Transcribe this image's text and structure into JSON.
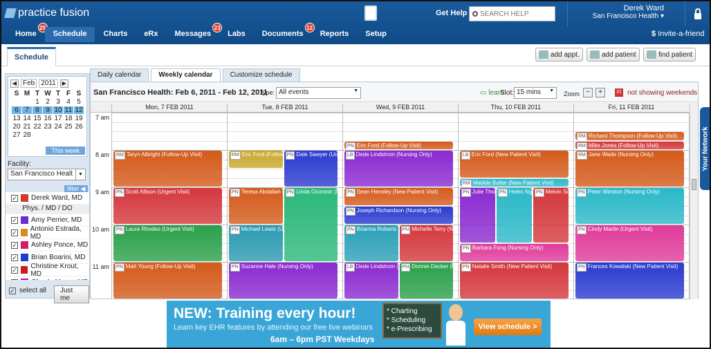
{
  "header": {
    "logo_text": "practice fusion",
    "get_help": "Get Help",
    "search_placeholder": "SEARCH HELP",
    "user_name": "Derek Ward",
    "user_clinic": "San Francisco Health",
    "invite": "Invite-a-friend"
  },
  "nav": [
    {
      "label": "Home",
      "badge": "29"
    },
    {
      "label": "Schedule",
      "badge": ""
    },
    {
      "label": "Charts",
      "badge": ""
    },
    {
      "label": "eRx",
      "badge": ""
    },
    {
      "label": "Messages",
      "badge": "23"
    },
    {
      "label": "Labs",
      "badge": ""
    },
    {
      "label": "Documents",
      "badge": "12"
    },
    {
      "label": "Reports",
      "badge": ""
    },
    {
      "label": "Setup",
      "badge": ""
    }
  ],
  "subbar": {
    "tab": "Schedule",
    "add_appt": "add appt.",
    "add_patient": "add patient",
    "find_patient": "find patient"
  },
  "minical": {
    "month": "Feb",
    "year": "2011",
    "days_header": [
      "S",
      "M",
      "T",
      "W",
      "T",
      "F",
      "S"
    ],
    "days": [
      "",
      "",
      "1",
      "2",
      "3",
      "4",
      "5",
      "6",
      "7",
      "8",
      "9",
      "10",
      "11",
      "12",
      "13",
      "14",
      "15",
      "16",
      "17",
      "18",
      "19",
      "20",
      "21",
      "22",
      "23",
      "24",
      "25",
      "26",
      "27",
      "28",
      "",
      "",
      "",
      "",
      ""
    ],
    "this_week": "This week"
  },
  "facility": {
    "label": "Facility:",
    "value": "San Francisco Healt"
  },
  "filter": "filter",
  "providers": {
    "self": {
      "name": "Derek Ward, MD",
      "color": "#d4372c"
    },
    "header": "Phys. / MD / DO",
    "list": [
      {
        "name": "Amy Perrier, MD",
        "color": "#6a2bd0"
      },
      {
        "name": "Antonio Estrada, MD",
        "color": "#d98a1c"
      },
      {
        "name": "Ashley Ponce, MD",
        "color": "#d61a6a"
      },
      {
        "name": "Brian Boarini, MD",
        "color": "#1a3ccf"
      },
      {
        "name": "Christine Krout, MD",
        "color": "#cf1a1a"
      },
      {
        "name": "Claude Meyer, MD",
        "color": "#9a1ac0"
      }
    ]
  },
  "select_all": "select all",
  "just_me": "Just me",
  "tabs": [
    "Daily calendar",
    "Weekly calendar",
    "Customize schedule"
  ],
  "calbar": {
    "range": "San Francisco Health:  Feb 6, 2011 - Feb 12, 2011",
    "type_label": "Type:",
    "type_value": "All events",
    "learn": "learn",
    "slot_label": "Slot:",
    "slot_value": "15 mins",
    "zoom_label": "Zoom",
    "weekends": "not showing weekends"
  },
  "days": [
    "Mon, 7 FEB 2011",
    "Tue, 8 FEB 2011",
    "Wed, 9 FEB 2011",
    "Thu, 10 FEB 2011",
    "Fri, 11 FEB 2011"
  ],
  "times": [
    "7 am",
    "8 am",
    "9 am",
    "10 am",
    "11 am"
  ],
  "appointments": [
    {
      "day": 0,
      "col": 0,
      "cols": 1,
      "start": 8.0,
      "end": 9.0,
      "tag": "RM",
      "text": "Taryn Albright (Follow-Up Visit)",
      "color": "#d45a1a"
    },
    {
      "day": 0,
      "col": 0,
      "cols": 1,
      "start": 9.0,
      "end": 10.0,
      "tag": "PN",
      "text": "Scott Allison (Urgent Visit)",
      "color": "#d4373c"
    },
    {
      "day": 0,
      "col": 0,
      "cols": 1,
      "start": 10.0,
      "end": 11.0,
      "tag": "PN",
      "text": "Laura Rhodes (Urgent Visit)",
      "color": "#2aa04a"
    },
    {
      "day": 0,
      "col": 0,
      "cols": 1,
      "start": 11.0,
      "end": 12.0,
      "tag": "PN",
      "text": "Matt Young (Follow-Up Visit)",
      "color": "#d45a1a"
    },
    {
      "day": 1,
      "col": 0,
      "cols": 2,
      "start": 8.0,
      "end": 8.5,
      "tag": "RM",
      "text": "Eric Ford (Follow-Up",
      "color": "#c8a82a"
    },
    {
      "day": 1,
      "col": 1,
      "cols": 2,
      "start": 8.0,
      "end": 9.0,
      "tag": "PN",
      "text": "Dale Sawyer (Urge",
      "color": "#2a3acf"
    },
    {
      "day": 1,
      "col": 0,
      "cols": 2,
      "start": 9.0,
      "end": 10.0,
      "tag": "PN",
      "text": "Teresa Abdallah (Ne",
      "color": "#d45a1a"
    },
    {
      "day": 1,
      "col": 1,
      "cols": 2,
      "start": 9.0,
      "end": 11.0,
      "tag": "PN",
      "text": "Linda Oconnor (Nursing",
      "color": "#2ab87a"
    },
    {
      "day": 1,
      "col": 0,
      "cols": 2,
      "start": 10.0,
      "end": 11.0,
      "tag": "PN",
      "text": "Michael Lewis (Urgent",
      "color": "#2a9ab0"
    },
    {
      "day": 1,
      "col": 0,
      "cols": 1,
      "start": 11.0,
      "end": 12.0,
      "tag": "PN",
      "text": "Suzanne Hale (Nursing Only)",
      "color": "#8a2ad0"
    },
    {
      "day": 2,
      "col": 0,
      "cols": 1,
      "start": 7.75,
      "end": 8.0,
      "tag": "PN",
      "text": "Eric Ford (Follow-Up Visit)",
      "color": "#d45a1a"
    },
    {
      "day": 2,
      "col": 0,
      "cols": 1,
      "start": 8.0,
      "end": 9.0,
      "tag": "LB",
      "text": "Dede Lindstrom (Nursing Only)",
      "color": "#8a2ad0"
    },
    {
      "day": 2,
      "col": 0,
      "cols": 1,
      "start": 9.0,
      "end": 9.5,
      "tag": "PN",
      "text": "Sean Hensley (New Patient Visit)",
      "color": "#d45a1a"
    },
    {
      "day": 2,
      "col": 0,
      "cols": 1,
      "start": 9.5,
      "end": 10.0,
      "tag": "PN",
      "text": "Joseph Richardson (Nursing Only)",
      "color": "#2a3acf"
    },
    {
      "day": 2,
      "col": 0,
      "cols": 2,
      "start": 10.0,
      "end": 11.0,
      "tag": "PN",
      "text": "Brianna Roberts (N",
      "color": "#2aa0b8"
    },
    {
      "day": 2,
      "col": 1,
      "cols": 2,
      "start": 10.0,
      "end": 11.0,
      "tag": "PN",
      "text": "Michelle Terry (N",
      "color": "#d4373c"
    },
    {
      "day": 2,
      "col": 0,
      "cols": 2,
      "start": 11.0,
      "end": 12.0,
      "tag": "LB",
      "text": "Dede Lindstrom (Nu",
      "color": "#8a2ad0"
    },
    {
      "day": 2,
      "col": 1,
      "cols": 2,
      "start": 11.0,
      "end": 12.0,
      "tag": "PN",
      "text": "Donnie Decker (Fo",
      "color": "#2aa04a"
    },
    {
      "day": 3,
      "col": 0,
      "cols": 1,
      "start": 8.0,
      "end": 8.75,
      "tag": "LB",
      "text": "Eric Ford (New Patient Visit)",
      "color": "#d45a1a"
    },
    {
      "day": 3,
      "col": 0,
      "cols": 1,
      "start": 8.75,
      "end": 9.0,
      "tag": "RM",
      "text": "Matilde Butler (New Patient Visit)",
      "color": "#2ab8c8"
    },
    {
      "day": 3,
      "col": 0,
      "cols": 3,
      "start": 9.0,
      "end": 10.5,
      "tag": "PN",
      "text": "Julie Thor",
      "color": "#8a2ad0"
    },
    {
      "day": 3,
      "col": 1,
      "cols": 3,
      "start": 9.0,
      "end": 10.5,
      "tag": "PN",
      "text": "Helen Ng",
      "color": "#2ab8c8"
    },
    {
      "day": 3,
      "col": 2,
      "cols": 3,
      "start": 9.0,
      "end": 10.5,
      "tag": "PN",
      "text": "Melvin Sc",
      "color": "#d4373c"
    },
    {
      "day": 3,
      "col": 0,
      "cols": 1,
      "start": 10.5,
      "end": 11.0,
      "tag": "PN",
      "text": "Barbara Fong (Nursing Only)",
      "color": "#e03a9a"
    },
    {
      "day": 3,
      "col": 0,
      "cols": 1,
      "start": 11.0,
      "end": 12.0,
      "tag": "PN",
      "text": "Natalie Smith (New Patient Visit)",
      "color": "#d4373c"
    },
    {
      "day": 4,
      "col": 0,
      "cols": 1,
      "start": 7.5,
      "end": 7.75,
      "tag": "RM",
      "text": "Richard Thompson (Follow-Up Visit)",
      "color": "#d45a1a"
    },
    {
      "day": 4,
      "col": 0,
      "cols": 1,
      "start": 7.75,
      "end": 8.0,
      "tag": "RM",
      "text": "Mike Jones (Follow-Up Visit)",
      "color": "#d4373c"
    },
    {
      "day": 4,
      "col": 0,
      "cols": 1,
      "start": 8.0,
      "end": 9.0,
      "tag": "RM",
      "text": "Jane Wade (Nursing Only)",
      "color": "#d45a1a"
    },
    {
      "day": 4,
      "col": 0,
      "cols": 1,
      "start": 9.0,
      "end": 10.0,
      "tag": "PN",
      "text": "Peter Winston (Nursing Only)",
      "color": "#2ab8c8"
    },
    {
      "day": 4,
      "col": 0,
      "cols": 1,
      "start": 10.0,
      "end": 11.0,
      "tag": "PN",
      "text": "Cindy Martin (Urgent Visit)",
      "color": "#e03a9a"
    },
    {
      "day": 4,
      "col": 0,
      "cols": 1,
      "start": 11.0,
      "end": 12.0,
      "tag": "PN",
      "text": "Frances Kowalski (New Patient Visit)",
      "color": "#2a3acf"
    }
  ],
  "your_network": "Your Network",
  "banner": {
    "title": "NEW: Training every hour!",
    "subtitle": "Learn key EHR features by attending our free  live webinars",
    "hours": "6am – 6pm PST Weekdays",
    "board": [
      "* Charting",
      "* Scheduling",
      "* e-Prescribing"
    ],
    "button": "View schedule >"
  }
}
